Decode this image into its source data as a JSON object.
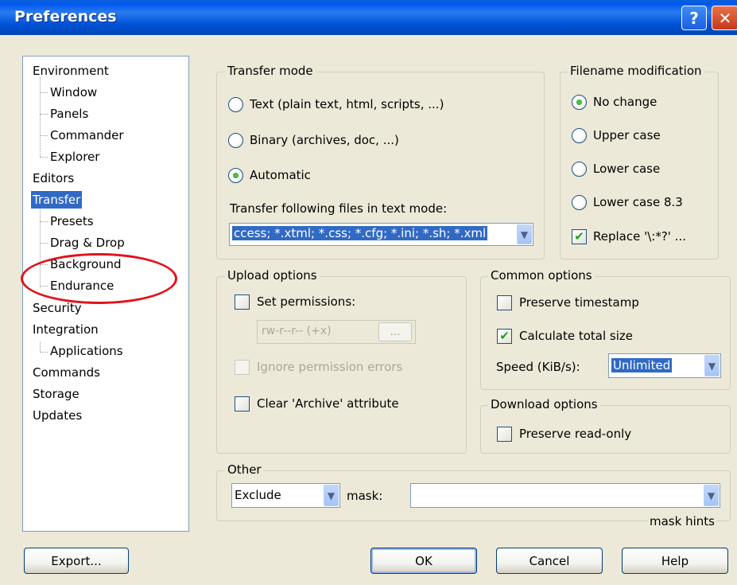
{
  "window": {
    "title": "Preferences",
    "help_glyph": "?",
    "close_glyph": "✕"
  },
  "tree": {
    "items": [
      {
        "label": "Environment"
      },
      {
        "label": "Window"
      },
      {
        "label": "Panels"
      },
      {
        "label": "Commander"
      },
      {
        "label": "Explorer"
      },
      {
        "label": "Editors"
      },
      {
        "label": "Transfer",
        "selected": true
      },
      {
        "label": "Presets"
      },
      {
        "label": "Drag & Drop"
      },
      {
        "label": "Background"
      },
      {
        "label": "Endurance"
      },
      {
        "label": "Security"
      },
      {
        "label": "Integration"
      },
      {
        "label": "Applications"
      },
      {
        "label": "Commands"
      },
      {
        "label": "Storage"
      },
      {
        "label": "Updates"
      }
    ]
  },
  "transfer_mode": {
    "title": "Transfer mode",
    "text_option": "Text (plain text, html, scripts, ...)",
    "binary_option": "Binary (archives, doc, ...)",
    "automatic_option": "Automatic",
    "selected": "Automatic",
    "textmode_label": "Transfer following files in text mode:",
    "textmode_value": "ccess; *.xtml; *.css; *.cfg; *.ini; *.sh; *.xml"
  },
  "filename_modification": {
    "title": "Filename modification",
    "options": [
      "No change",
      "Upper case",
      "Lower case",
      "Lower case 8.3"
    ],
    "selected": "No change",
    "replace_label": "Replace '\\:*?' ...",
    "replace_checked": true
  },
  "upload_options": {
    "title": "Upload options",
    "set_permissions": "Set permissions:",
    "permissions_value": "rw-r--r-- (+x)",
    "ellipsis": "...",
    "ignore_errors": "Ignore permission errors",
    "clear_archive": "Clear 'Archive' attribute"
  },
  "common_options": {
    "title": "Common options",
    "preserve_timestamp": "Preserve timestamp",
    "preserve_timestamp_checked": false,
    "calculate_total_size": "Calculate total size",
    "calculate_total_size_checked": true,
    "speed_label": "Speed (KiB/s):",
    "speed_value": "Unlimited"
  },
  "download_options": {
    "title": "Download options",
    "preserve_readonly": "Preserve read-only",
    "preserve_readonly_checked": false
  },
  "other": {
    "title": "Other",
    "mask_mode": "Exclude",
    "mask_label": "mask:",
    "mask_value": "",
    "mask_hints": "mask hints"
  },
  "buttons": {
    "export": "Export...",
    "ok": "OK",
    "cancel": "Cancel",
    "help": "Help"
  },
  "glyphs": {
    "checkmark": "✔",
    "dropdown": "▼"
  },
  "colors": {
    "annotation": "#e0141c",
    "selection": "#316ac5"
  }
}
